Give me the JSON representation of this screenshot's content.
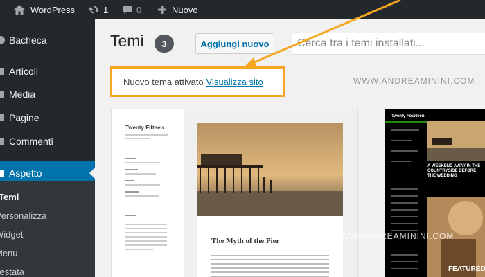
{
  "adminbar": {
    "site_name": "WordPress",
    "updates_count": "1",
    "comments_count": "0",
    "new_label": "Nuovo"
  },
  "sidebar": {
    "items": [
      {
        "label": "Bacheca",
        "icon": "dashboard-icon"
      },
      {
        "label": "Articoli",
        "icon": "pin-icon"
      },
      {
        "label": "Media",
        "icon": "media-icon"
      },
      {
        "label": "Pagine",
        "icon": "pages-icon"
      },
      {
        "label": "Commenti",
        "icon": "comments-icon"
      },
      {
        "label": "Aspetto",
        "icon": "appearance-icon",
        "active": true
      }
    ],
    "submenu": [
      "Temi",
      "Personalizza",
      "Widget",
      "Menu",
      "Testata"
    ]
  },
  "header": {
    "title": "Temi",
    "count": "3",
    "add_new_label": "Aggiungi nuovo",
    "search_placeholder": "Cerca tra i temi installati..."
  },
  "notice": {
    "text": "Nuovo tema attivato",
    "link": "Visualizza sito"
  },
  "themes": [
    {
      "name": "Twenty Fifteen",
      "post_title": "The Myth of the Pier"
    },
    {
      "name": "Twenty Fourteen",
      "headline": "A WEEKEND AWAY IN THE COUNTRYSIDE BEFORE THE WEDDING",
      "featured_label": "FEATURED"
    }
  ],
  "watermark": "WWW.ANDREAMININI.COM",
  "colors": {
    "adminbar": "#23282d",
    "active": "#0073aa",
    "highlight": "#f5a623"
  }
}
